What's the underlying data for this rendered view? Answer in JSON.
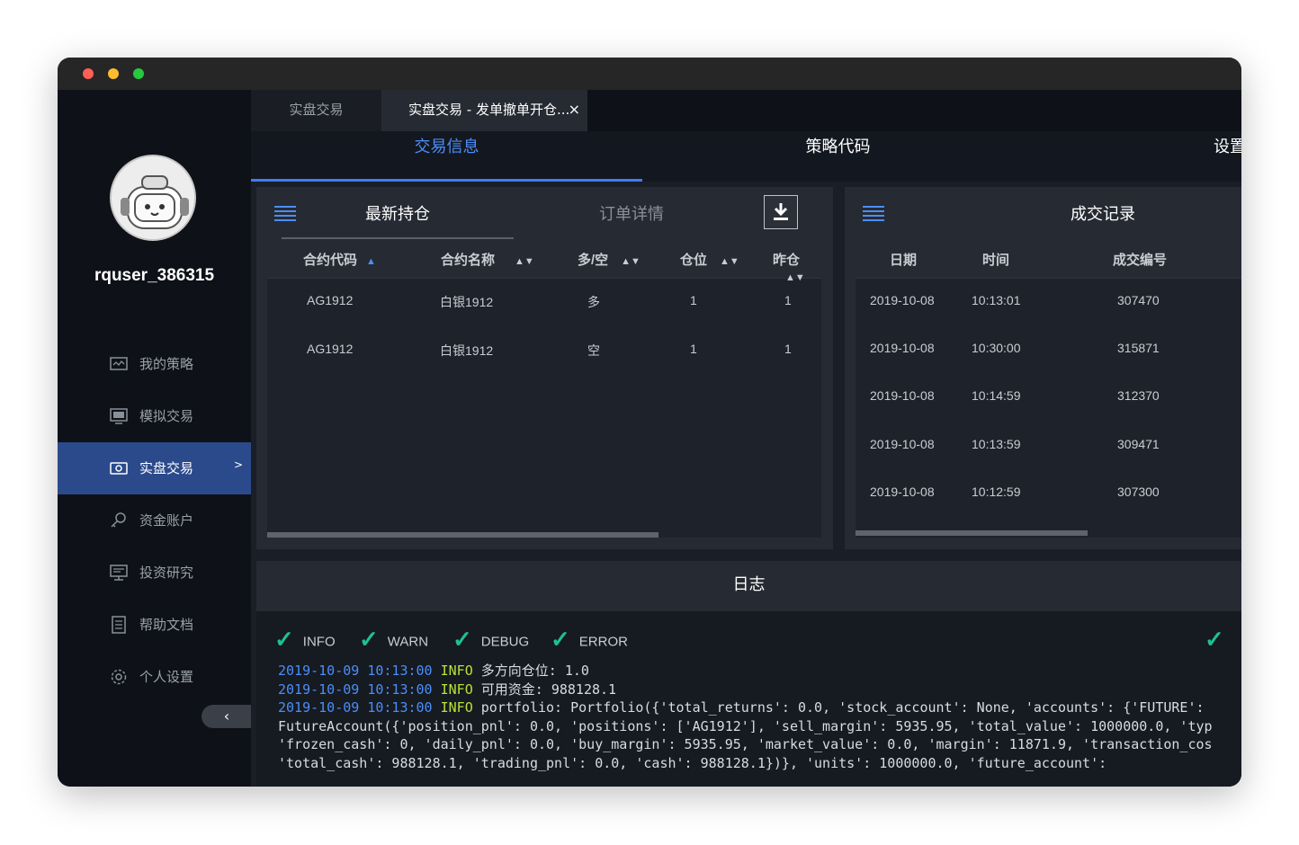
{
  "window": {
    "controls": [
      "close",
      "minimize",
      "maximize"
    ]
  },
  "sidebar": {
    "username": "rquser_386315",
    "items": [
      {
        "label": "我的策略",
        "icon": "strategy-icon",
        "active": false
      },
      {
        "label": "模拟交易",
        "icon": "simulation-icon",
        "active": false
      },
      {
        "label": "实盘交易",
        "icon": "live-trade-icon",
        "active": true,
        "arrow": ">"
      },
      {
        "label": "资金账户",
        "icon": "key-icon",
        "active": false
      },
      {
        "label": "投资研究",
        "icon": "research-icon",
        "active": false
      },
      {
        "label": "帮助文档",
        "icon": "document-icon",
        "active": false
      },
      {
        "label": "个人设置",
        "icon": "gear-icon",
        "active": false
      }
    ],
    "collapse_label": "‹"
  },
  "tabs": [
    {
      "label": "实盘交易"
    },
    {
      "label": "实盘交易 - 发单撤单开仓...",
      "close": "×"
    }
  ],
  "subtabs": [
    {
      "label": "交易信息",
      "active": true
    },
    {
      "label": "策略代码",
      "active": false
    },
    {
      "label": "设置",
      "active": false
    }
  ],
  "positions_panel": {
    "tab_active": "最新持仓",
    "tab_inactive": "订单详情",
    "columns": [
      "合约代码",
      "合约名称",
      "多/空",
      "仓位",
      "昨仓"
    ],
    "rows": [
      [
        "AG1912",
        "白银1912",
        "多",
        "1",
        "1"
      ],
      [
        "AG1912",
        "白银1912",
        "空",
        "1",
        "1"
      ]
    ]
  },
  "trades_panel": {
    "title": "成交记录",
    "columns": [
      "日期",
      "时间",
      "成交编号"
    ],
    "rows": [
      [
        "2019-10-08",
        "10:13:01",
        "307470"
      ],
      [
        "2019-10-08",
        "10:30:00",
        "315871"
      ],
      [
        "2019-10-08",
        "10:14:59",
        "312370"
      ],
      [
        "2019-10-08",
        "10:13:59",
        "309471"
      ],
      [
        "2019-10-08",
        "10:12:59",
        "307300"
      ]
    ]
  },
  "log": {
    "title": "日志",
    "filters": [
      "INFO",
      "WARN",
      "DEBUG",
      "ERROR"
    ],
    "lines": [
      {
        "time": "2019-10-09 10:13:00",
        "level": "INFO",
        "text": " 多方向仓位:  1.0"
      },
      {
        "time": "2019-10-09 10:13:00",
        "level": "INFO",
        "text": " 可用资金:  988128.1"
      },
      {
        "time": "2019-10-09 10:13:00",
        "level": "INFO",
        "text": " portfolio: Portfolio({'total_returns': 0.0, 'stock_account': None, 'accounts': {'FUTURE':"
      },
      {
        "time": "",
        "level": "",
        "text": "FutureAccount({'position_pnl': 0.0, 'positions': ['AG1912'], 'sell_margin': 5935.95, 'total_value': 1000000.0, 'typ"
      },
      {
        "time": "",
        "level": "",
        "text": "'frozen_cash': 0, 'daily_pnl': 0.0, 'buy_margin': 5935.95, 'market_value': 0.0, 'margin': 11871.9, 'transaction_cos"
      },
      {
        "time": "",
        "level": "",
        "text": "'total_cash': 988128.1, 'trading_pnl': 0.0, 'cash': 988128.1})}, 'units': 1000000.0, 'future_account':"
      }
    ]
  },
  "colors": {
    "accent": "#3c7ef2",
    "check": "#1fbf95",
    "log_time": "#4b8ef7",
    "log_level": "#b7e43a"
  }
}
